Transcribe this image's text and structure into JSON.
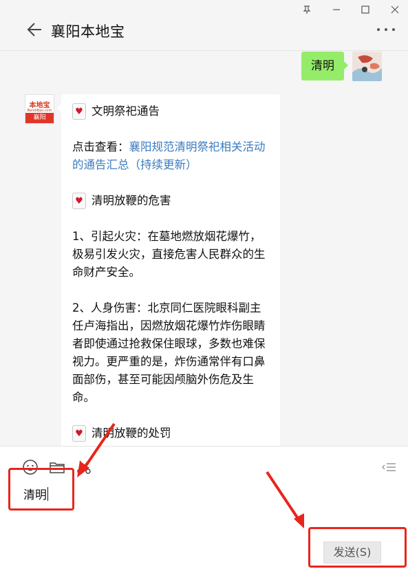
{
  "window": {
    "title": "襄阳本地宝",
    "pin_icon": "pin-icon",
    "minimize_icon": "minimize-icon",
    "maximize_icon": "maximize-icon",
    "close_icon": "close-icon"
  },
  "chat": {
    "sent_message": "清明",
    "official_account": {
      "logo_text": "本地宝",
      "logo_subtext": "BendiBao.com",
      "logo_city": "襄阳"
    },
    "reply": {
      "section1_title": "文明祭祀通告",
      "link_prefix": "点击查看：",
      "link_text": "襄阳规范清明祭祀相关活动的通告汇总（持续更新）",
      "section2_title": "清明放鞭的危害",
      "item1": "1、引起火灾：在墓地燃放烟花爆竹，极易引发火灾，直接危害人民群众的生命财产安全。",
      "item2": "2、人身伤害：北京同仁医院眼科副主任卢海指出，因燃放烟花爆竹炸伤眼睛者即使通过抢救保住眼球，多数也难保视力。更严重的是，炸伤通常伴有口鼻面部伤，甚至可能因颅脑外伤危及生命。",
      "section3_title": "清明放鞭的处罚"
    }
  },
  "input": {
    "value": "清明",
    "send_label": "发送(S)"
  },
  "colors": {
    "bubble_sent": "#95ec69",
    "link": "#3b7bbf",
    "annotation_red": "#e8251b"
  }
}
